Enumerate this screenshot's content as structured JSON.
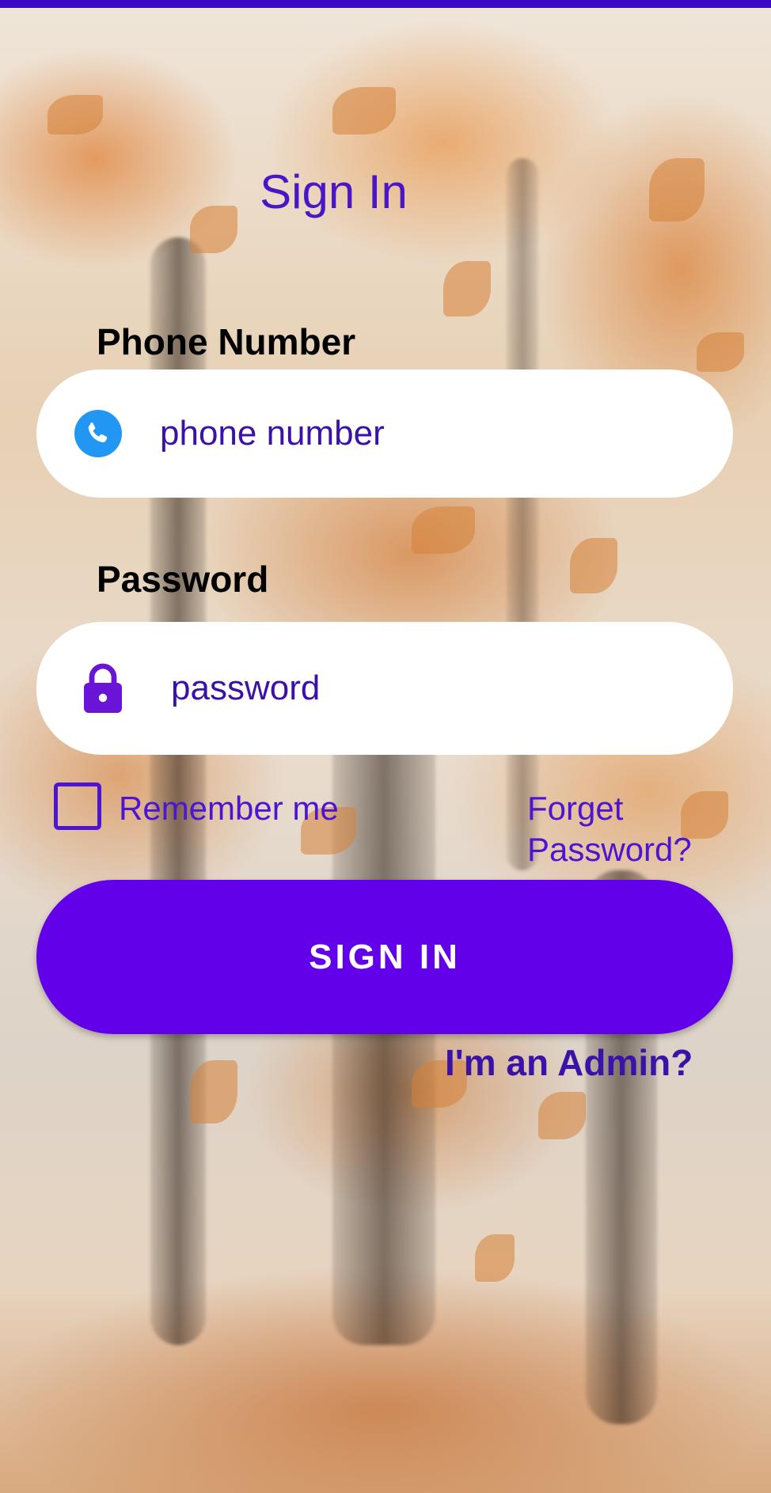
{
  "screen": {
    "title": "Sign In"
  },
  "phone": {
    "label": "Phone Number",
    "placeholder": "phone number",
    "icon": "phone-icon"
  },
  "password": {
    "label": "Password",
    "placeholder": "password",
    "icon": "lock-icon"
  },
  "options": {
    "remember_label": "Remember me",
    "remember_checked": false,
    "forgot_line1": "Forget",
    "forgot_line2": "Password?"
  },
  "actions": {
    "signin_label": "SIGN IN",
    "admin_link": "I'm an Admin?"
  },
  "colors": {
    "status_bar": "#3a08c2",
    "accent": "#6200ea",
    "link": "#4d14d1",
    "phone_icon": "#2196f3"
  }
}
